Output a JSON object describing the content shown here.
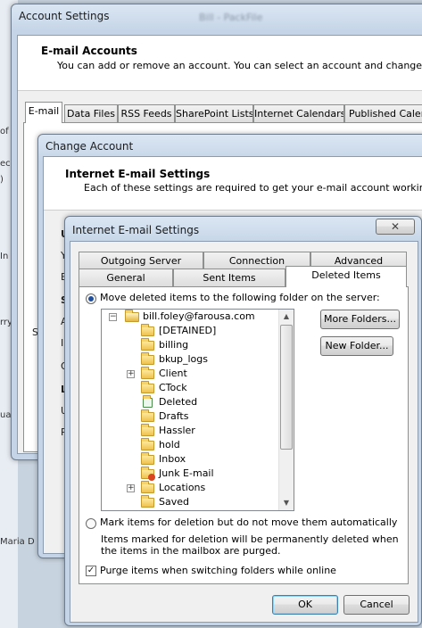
{
  "background_app": {
    "fragments": [
      "of",
      "ece",
      ")",
      "In",
      "rry",
      "ua",
      "Maria D"
    ],
    "blurred_title": "Bill - PackFile"
  },
  "account_settings": {
    "title": "Account Settings",
    "header_title": "E-mail Accounts",
    "header_sub": "You can add or remove an account. You can select an account and change its settings.",
    "tabs": [
      "E-mail",
      "Data Files",
      "RSS Feeds",
      "SharePoint Lists",
      "Internet Calendars",
      "Published Calendars"
    ],
    "selected_tab": "E-mail",
    "side_fragment": "S"
  },
  "change_account": {
    "title": "Change Account",
    "header_title": "Internet E-mail Settings",
    "header_sub": "Each of these settings are required to get your e-mail account working.",
    "left_fragments": [
      "U",
      "Y",
      "E",
      "S",
      "A",
      "In",
      "O",
      "L",
      "U",
      "P"
    ]
  },
  "internet_email_settings": {
    "title": "Internet E-mail Settings",
    "close_glyph": "✕",
    "tabs_back": [
      "Outgoing Server",
      "Connection",
      "Advanced"
    ],
    "tabs_front": [
      "General",
      "Sent Items",
      "Deleted Items"
    ],
    "selected_tab": "Deleted Items",
    "option_move": "Move deleted items to the following folder on the server:",
    "option_mark": "Mark items for deletion but do not move them automatically",
    "mark_note": "Items marked for deletion will be permanently deleted when the items in the mailbox are purged.",
    "purge_label": "Purge items when switching folders while online",
    "more_folders": "More Folders...",
    "new_folder": "New Folder...",
    "ok": "OK",
    "cancel": "Cancel",
    "folder_tree": {
      "root": "bill.foley@farousa.com",
      "items": [
        {
          "name": "[DETAINED]",
          "icon": "folder-icon",
          "expandable": false
        },
        {
          "name": "billing",
          "icon": "folder-icon",
          "expandable": false
        },
        {
          "name": "bkup_logs",
          "icon": "folder-icon",
          "expandable": false
        },
        {
          "name": "Client",
          "icon": "folder-icon",
          "expandable": true
        },
        {
          "name": "CTock",
          "icon": "folder-icon",
          "expandable": false
        },
        {
          "name": "Deleted",
          "icon": "recycle-bin-icon",
          "expandable": false
        },
        {
          "name": "Drafts",
          "icon": "folder-icon",
          "expandable": false
        },
        {
          "name": "Hassler",
          "icon": "folder-icon",
          "expandable": false
        },
        {
          "name": "hold",
          "icon": "folder-icon",
          "expandable": false
        },
        {
          "name": "Inbox",
          "icon": "folder-icon",
          "expandable": false
        },
        {
          "name": "Junk E-mail",
          "icon": "junk-folder-icon",
          "expandable": false
        },
        {
          "name": "Locations",
          "icon": "folder-icon",
          "expandable": true
        },
        {
          "name": "Saved",
          "icon": "folder-icon",
          "expandable": false
        }
      ]
    }
  }
}
